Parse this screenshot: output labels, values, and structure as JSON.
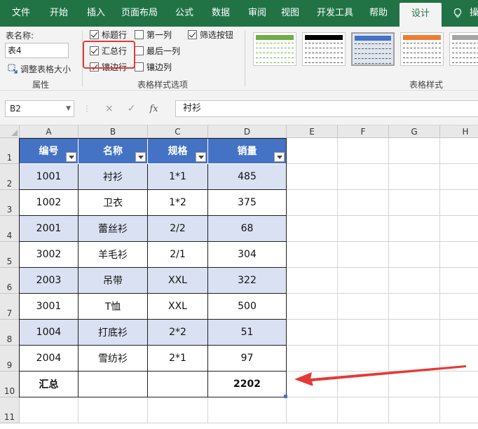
{
  "ribbon_tabs": [
    "文件",
    "开始",
    "插入",
    "页面布局",
    "公式",
    "数据",
    "审阅",
    "视图",
    "开发工具",
    "帮助",
    "设计"
  ],
  "ribbon_tab_cut": "操",
  "properties": {
    "table_name_label": "表名称:",
    "table_name_value": "表4",
    "resize_label": "调整表格大小",
    "group_title": "属性"
  },
  "style_options": {
    "header_row": "标题行",
    "first_column": "第一列",
    "filter_button": "筛选按钮",
    "total_row": "汇总行",
    "last_column": "最后一列",
    "banded_rows": "镶边行",
    "banded_columns": "镶边列",
    "group_title": "表格样式选项"
  },
  "table_styles": {
    "group_title": "表格样式",
    "swatch_colors": [
      "#70ad47",
      "#000000",
      "#4472c4",
      "#ed7d31",
      "#a5a5a5"
    ]
  },
  "formula_bar": {
    "cell_ref": "B2",
    "cancel_icon": "×",
    "enter_icon": "✓",
    "fx_icon": "fx",
    "value": "衬衫"
  },
  "sheet": {
    "columns": [
      "A",
      "B",
      "C",
      "D",
      "E",
      "F",
      "G",
      "H"
    ],
    "rows": [
      "1",
      "2",
      "3",
      "4",
      "5",
      "6",
      "7",
      "8",
      "9",
      "10",
      "11"
    ],
    "headers": [
      "编号",
      "名称",
      "规格",
      "销量"
    ],
    "data": [
      [
        "1001",
        "衬衫",
        "1*1",
        "485"
      ],
      [
        "1002",
        "卫衣",
        "1*2",
        "375"
      ],
      [
        "2001",
        "蕾丝衫",
        "2/2",
        "68"
      ],
      [
        "3002",
        "羊毛衫",
        "2/1",
        "304"
      ],
      [
        "2003",
        "吊带",
        "XXL",
        "322"
      ],
      [
        "3001",
        "T恤",
        "XXL",
        "500"
      ],
      [
        "1004",
        "打底衫",
        "2*2",
        "51"
      ],
      [
        "2004",
        "雪纺衫",
        "2*1",
        "97"
      ]
    ],
    "total_label": "汇总",
    "total_value": "2202"
  },
  "colors": {
    "ribbon_green": "#217346",
    "table_header": "#4472c4",
    "table_band": "#d9e1f2",
    "annotation_red": "#e53935"
  }
}
